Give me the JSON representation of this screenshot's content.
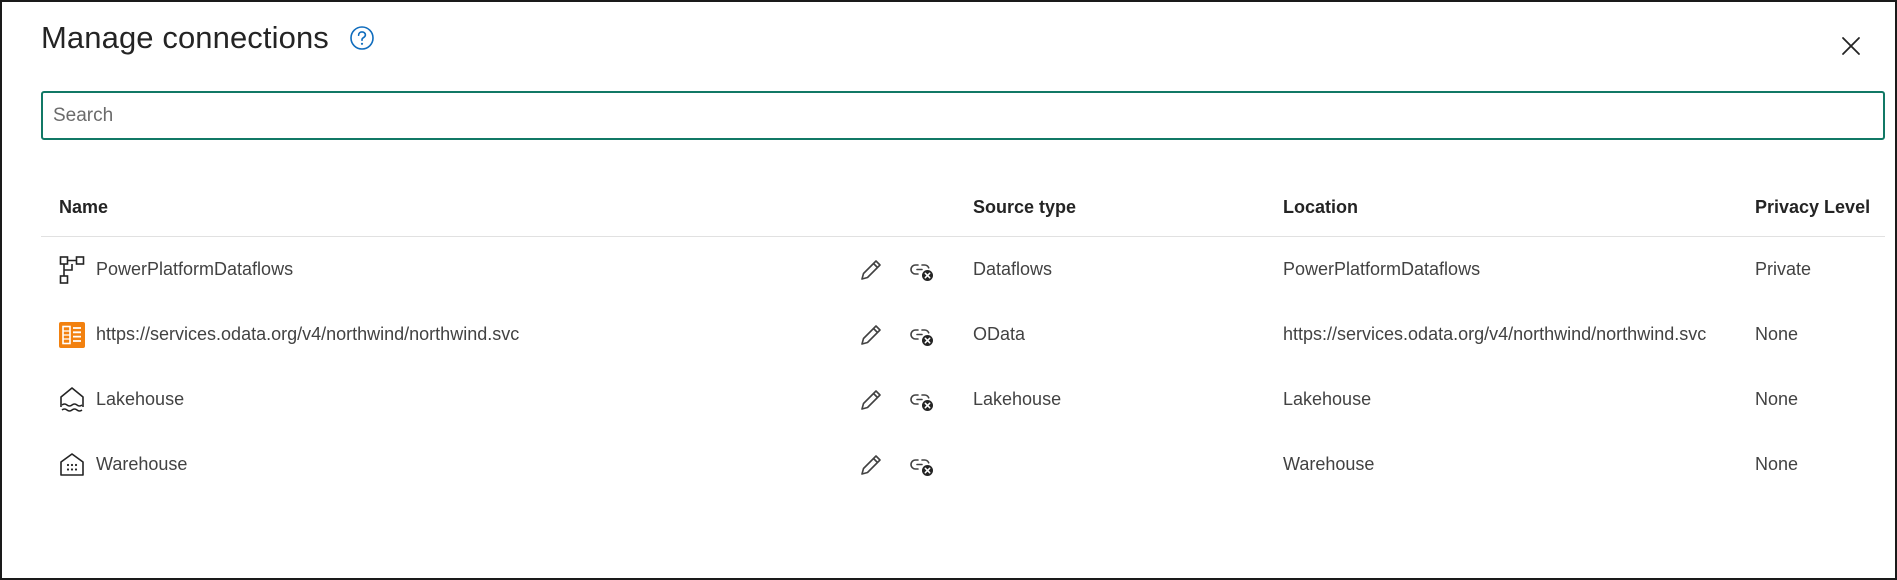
{
  "dialog": {
    "title": "Manage connections"
  },
  "search": {
    "placeholder": "Search",
    "value": ""
  },
  "table": {
    "headers": {
      "name": "Name",
      "source_type": "Source type",
      "location": "Location",
      "privacy_level": "Privacy Level"
    },
    "rows": [
      {
        "icon": "dataflow-icon",
        "name": "PowerPlatformDataflows",
        "source_type": "Dataflows",
        "location": "PowerPlatformDataflows",
        "privacy_level": "Private"
      },
      {
        "icon": "odata-icon",
        "name": "https://services.odata.org/v4/northwind/northwind.svc",
        "source_type": "OData",
        "location": "https://services.odata.org/v4/northwind/northwind.svc",
        "privacy_level": "None"
      },
      {
        "icon": "lakehouse-icon",
        "name": "Lakehouse",
        "source_type": "Lakehouse",
        "location": "Lakehouse",
        "privacy_level": "None"
      },
      {
        "icon": "warehouse-icon",
        "name": "Warehouse",
        "source_type": "",
        "location": "Warehouse",
        "privacy_level": "None"
      }
    ]
  },
  "colors": {
    "accent": "#117865",
    "help": "#0f6cbd",
    "odata": "#f2810f"
  }
}
